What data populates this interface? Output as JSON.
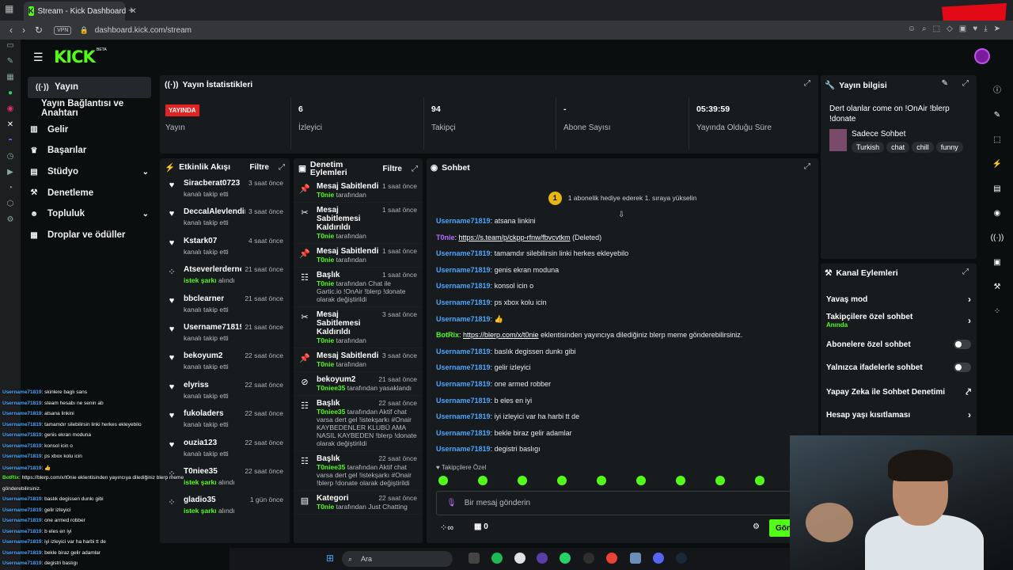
{
  "browser": {
    "tab_title": "Stream - Kick Dashboard",
    "url": "dashboard.kick.com/stream",
    "vpn": "VPN"
  },
  "brand": {
    "logo": "KICK",
    "beta": "BETA",
    "accent": "#53fc18"
  },
  "nav": [
    {
      "label": "Yayın"
    },
    {
      "label": "Yayın Bağlantısı ve Anahtarı"
    },
    {
      "label": "Gelir"
    },
    {
      "label": "Başarılar"
    },
    {
      "label": "Stüdyo"
    },
    {
      "label": "Denetleme"
    },
    {
      "label": "Topluluk"
    },
    {
      "label": "Droplar ve ödüller"
    }
  ],
  "stats": {
    "title": "Yayın İstatistikleri",
    "live_badge": "YAYINDA",
    "items": [
      {
        "value": "",
        "label": "Yayın"
      },
      {
        "value": "6",
        "label": "İzleyici"
      },
      {
        "value": "94",
        "label": "Takipçi"
      },
      {
        "value": "-",
        "label": "Abone Sayısı"
      },
      {
        "value": "05:39:59",
        "label": "Yayında Olduğu Süre"
      }
    ]
  },
  "activity": {
    "title": "Etkinlik Akışı",
    "filter": "Filtre",
    "items": [
      {
        "name": "Siracberat0723",
        "time": "3 saat önce",
        "sub": "kanalı takip etti"
      },
      {
        "name": "DeccalAlevlendiren3131",
        "time": "3 saat önce",
        "sub": "kanalı takip etti"
      },
      {
        "name": "Kstark07",
        "time": "4 saat önce",
        "sub": "kanalı takip etti"
      },
      {
        "name": "Atseverlerdernegi",
        "time": "21 saat önce",
        "sub_hl": "istek şarkı",
        "sub": "alındı"
      },
      {
        "name": "bbclearner",
        "time": "21 saat önce",
        "sub": "kanalı takip etti"
      },
      {
        "name": "Username71819",
        "time": "21 saat önce",
        "sub": "kanalı takip etti"
      },
      {
        "name": "bekoyum2",
        "time": "22 saat önce",
        "sub": "kanalı takip etti"
      },
      {
        "name": "elyriss",
        "time": "22 saat önce",
        "sub": "kanalı takip etti"
      },
      {
        "name": "fukoladers",
        "time": "22 saat önce",
        "sub": "kanalı takip etti"
      },
      {
        "name": "ouzia123",
        "time": "22 saat önce",
        "sub": "kanalı takip etti"
      },
      {
        "name": "T0niee35",
        "time": "22 saat önce",
        "sub_hl": "istek şarkı",
        "sub": "alındı"
      },
      {
        "name": "gladio35",
        "time": "1 gün önce",
        "sub_hl": "istek şarkı",
        "sub": "alındı"
      }
    ]
  },
  "moderation": {
    "title": "Denetim Eylemleri",
    "filter": "Filtre",
    "items": [
      {
        "title": "Mesaj Sabitlendi",
        "time": "1 saat önce",
        "who": "T0nie",
        "sub": "tarafından"
      },
      {
        "title": "Mesaj Sabitlemesi Kaldırıldı",
        "time": "1 saat önce",
        "who": "T0nie",
        "sub": "tarafından"
      },
      {
        "title": "Mesaj Sabitlendi",
        "time": "1 saat önce",
        "who": "T0nie",
        "sub": "tarafından"
      },
      {
        "title": "Başlık",
        "time": "1 saat önce",
        "who": "T0nie",
        "sub": "tarafından Chat ile Gartic.io !OnAir !blerp !donate olarak değiştirildi"
      },
      {
        "title": "Mesaj Sabitlemesi Kaldırıldı",
        "time": "3 saat önce",
        "who": "T0nie",
        "sub": "tarafından"
      },
      {
        "title": "Mesaj Sabitlendi",
        "time": "3 saat önce",
        "who": "T0nie",
        "sub": "tarafından"
      },
      {
        "title": "bekoyum2",
        "time": "21 saat önce",
        "who": "T0niee35",
        "sub": "tarafından yasaklandı"
      },
      {
        "title": "Başlık",
        "time": "22 saat önce",
        "who": "T0niee35",
        "sub": "tarafından Aktif chat varsa dert gel !istekşarkı #Onair KAYBEDENLER KLUBÜ AMA NASIL KAYBEDEN !blerp !donate olarak değiştirildi"
      },
      {
        "title": "Başlık",
        "time": "22 saat önce",
        "who": "T0niee35",
        "sub": "tarafından Aktif chat varsa dert gel !istekşarkı #Onair !blerp !donate olarak değiştirildi"
      },
      {
        "title": "Kategori",
        "time": "22 saat önce",
        "who": "T0nie",
        "sub": "tarafından Just Chatting"
      }
    ]
  },
  "chat": {
    "title": "Sohbet",
    "pinned_count": "1",
    "pinned": "1 abonelik hediye ederek 1. sıraya yükselin",
    "messages": [
      {
        "user": "Username71819",
        "text": "atsana linkini"
      },
      {
        "user": "T0nie",
        "link": "https://s.team/p/ckpp-rfnw/fbvcvtkm",
        "text": "(Deleted)"
      },
      {
        "user": "Username71819",
        "text": "tamamdır silebilirsin linki herkes ekleyebilo"
      },
      {
        "user": "Username71819",
        "text": "genis ekran moduna"
      },
      {
        "user": "Username71819",
        "text": "konsol icin o"
      },
      {
        "user": "Username71819",
        "text": "ps xbox kolu icin"
      },
      {
        "user": "Username71819",
        "text": "👍"
      },
      {
        "user": "BotRix",
        "link": "https://blerp.com/x/t0nie",
        "text": "eklentisinden yayıncıya dilediğiniz blerp meme gönderebilirsiniz."
      },
      {
        "user": "Username71819",
        "text": "baslık degissen dunkı gibi"
      },
      {
        "user": "Username71819",
        "text": "gelir izleyici"
      },
      {
        "user": "Username71819",
        "text": "one armed robber"
      },
      {
        "user": "Username71819",
        "text": "b eles en iyi"
      },
      {
        "user": "Username71819",
        "text": "iyi izleyici var ha harbi tt de"
      },
      {
        "user": "Username71819",
        "text": "bekle biraz gelir adamlar"
      },
      {
        "user": "Username71819",
        "text": "degistri baslıgı"
      }
    ],
    "followers_only": "Takipçilere Özel",
    "placeholder": "Bir mesaj gönderin",
    "counter": "0",
    "send": "Gön"
  },
  "info": {
    "title": "Yayın bilgisi",
    "stream_title": "Dert olanlar come on !OnAir !blerp !donate",
    "category": "Sadece Sohbet",
    "tags": [
      "Turkish",
      "chat",
      "chill",
      "funny"
    ]
  },
  "channel_actions": {
    "title": "Kanal Eylemleri",
    "items": [
      {
        "label": "Yavaş mod",
        "kind": "chevron"
      },
      {
        "label": "Takipçilere özel sohbet",
        "sub": "Anında",
        "kind": "chevron"
      },
      {
        "label": "Abonelere özel sohbet",
        "kind": "toggle"
      },
      {
        "label": "Yalnızca ifadelerle sohbet",
        "kind": "toggle"
      },
      {
        "label": "Yapay Zeka ile Sohbet Denetimi",
        "kind": "external"
      },
      {
        "label": "Hesap yaşı kısıtlaması",
        "kind": "chevron"
      }
    ]
  },
  "overlay": [
    {
      "user": "Username71819",
      "text": "skinlere baglı sans"
    },
    {
      "user": "Username71819",
      "text": "steam hesabı ne senin ab"
    },
    {
      "user": "Username71819",
      "text": "atsana linkini"
    },
    {
      "user": "Username71819",
      "text": "tamamdır silebilirsin linki herkes ekleyebilo"
    },
    {
      "user": "Username71819",
      "text": "genis ekran moduna"
    },
    {
      "user": "Username71819",
      "text": "konsol icin o"
    },
    {
      "user": "Username71819",
      "text": "ps xbox kolu icin"
    },
    {
      "user": "Username71819",
      "text": "👍"
    },
    {
      "user": "BotRix",
      "text": "https://blerp.com/x/t0nie eklentisinden yayıncıya dilediğiniz blerp meme"
    },
    {
      "user": "",
      "text": "gönderebilirsiniz."
    },
    {
      "user": "Username71819",
      "text": "baslık degissen dunkı gibi"
    },
    {
      "user": "Username71819",
      "text": "gelir izleyici"
    },
    {
      "user": "Username71819",
      "text": "one armed robber"
    },
    {
      "user": "Username71819",
      "text": "b eles en iyi"
    },
    {
      "user": "Username71819",
      "text": "iyi izleyici var ha harbi tt de"
    },
    {
      "user": "Username71819",
      "text": "bekle biraz gelir adamlar"
    },
    {
      "user": "Username71819",
      "text": "degistri baslıgı"
    }
  ],
  "taskbar": {
    "search": "Ara"
  }
}
